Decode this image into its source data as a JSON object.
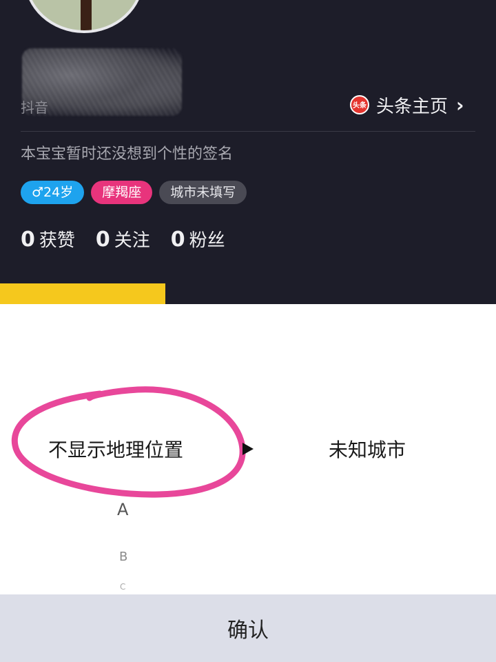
{
  "profile": {
    "app_label": "抖音",
    "toutiao": {
      "icon_text": "头条",
      "label": "头条主页"
    },
    "signature": "本宝宝暂时还没想到个性的签名",
    "tags": {
      "gender_age": "♂24岁",
      "zodiac": "摩羯座",
      "city": "城市未填写"
    },
    "stats": [
      {
        "num": "0",
        "label": "获赞"
      },
      {
        "num": "0",
        "label": "关注"
      },
      {
        "num": "0",
        "label": "粉丝"
      }
    ]
  },
  "picker": {
    "left_selected": "不显示地理位置",
    "right_selected": "未知城市",
    "letters": [
      "A",
      "B",
      "C"
    ]
  },
  "confirm_label": "确认",
  "colors": {
    "background": "#1d1d29",
    "tag_gender": "#1ea3ee",
    "tag_zodiac": "#e8347c",
    "tab_active": "#f5c81d",
    "annotation_circle": "#e8479a"
  }
}
